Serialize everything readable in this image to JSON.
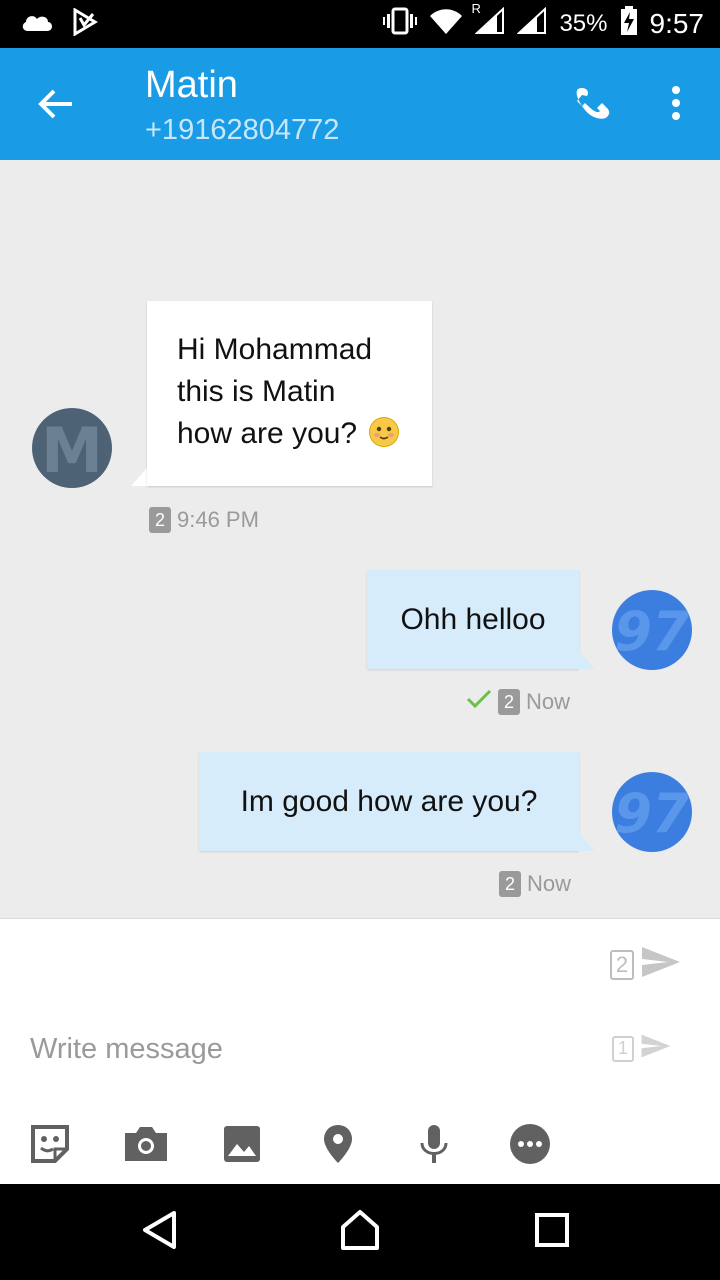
{
  "status_bar": {
    "battery": "35%",
    "time": "9:57",
    "roaming_indicator": "R",
    "icons": [
      "cloud-icon",
      "play-store-icon",
      "vibrate-icon",
      "wifi-icon",
      "signal-icon",
      "battery-charging-icon"
    ]
  },
  "header": {
    "contact_name": "Matin",
    "contact_number": "+19162804772",
    "icons": [
      "back-arrow-icon",
      "phone-icon",
      "more-vert-icon"
    ]
  },
  "messages": [
    {
      "direction": "incoming",
      "avatar_letter": "M",
      "lines": [
        "Hi Mohammad",
        "this is Matin",
        "how are you?"
      ],
      "emoji": "slightly-smiling-face",
      "sim": "2",
      "time": "9:46 PM"
    },
    {
      "direction": "outgoing",
      "avatar_glyph": "97",
      "text": "Ohh helloo",
      "delivered": true,
      "sim": "2",
      "time": "Now"
    },
    {
      "direction": "outgoing",
      "avatar_glyph": "97",
      "text": "Im good how are you?",
      "delivered": false,
      "sim": "2",
      "time": "Now"
    }
  ],
  "composer": {
    "placeholder": "Write message",
    "send_sim2": "2",
    "send_sim1": "1",
    "tools": [
      "sticker-icon",
      "camera-icon",
      "image-icon",
      "location-icon",
      "microphone-icon",
      "more-options-icon"
    ]
  },
  "nav_bar": {
    "buttons": [
      "back-icon",
      "home-icon",
      "recents-icon"
    ]
  },
  "colors": {
    "app_bar": "#1a9be6",
    "outgoing_bubble": "#d6ecfa",
    "incoming_bubble": "#ffffff",
    "chat_background": "#ececec",
    "check_green": "#6cc04a"
  }
}
